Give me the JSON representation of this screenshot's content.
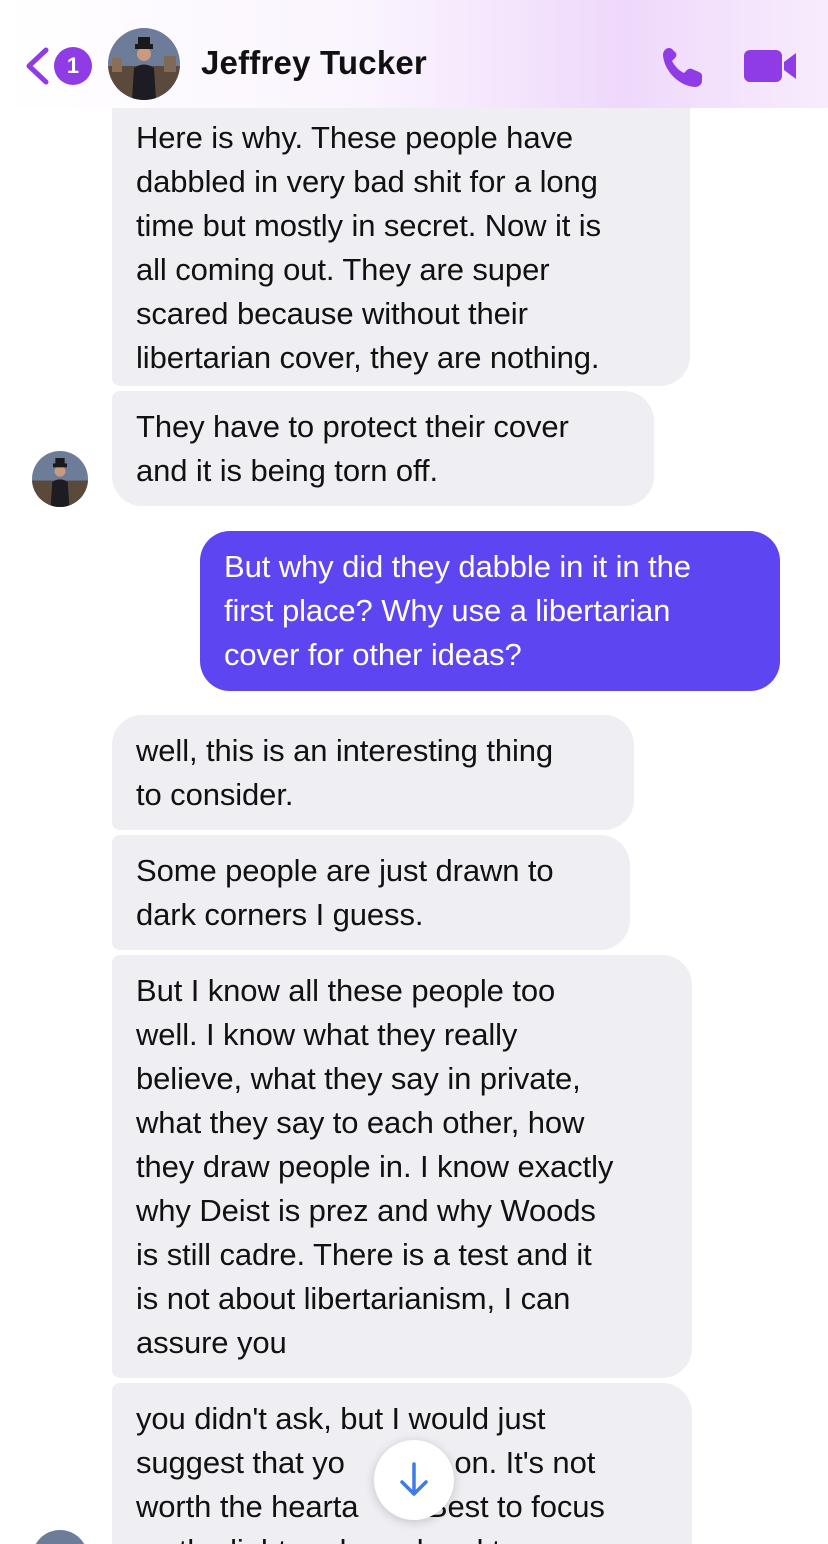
{
  "header": {
    "back_badge_count": "1",
    "contact_name": "Jeffrey Tucker",
    "accent_color": "#8f3ce6",
    "icons": [
      "chevron-left-icon",
      "phone-icon",
      "video-camera-icon"
    ]
  },
  "messages": [
    {
      "direction": "incoming",
      "lines": [
        "Here is why. These people have",
        "dabbled in very bad shit for a long",
        "time but mostly in secret. Now it is",
        "all coming out. They are super",
        "scared because without their",
        "libertarian cover, they are nothing."
      ]
    },
    {
      "direction": "incoming",
      "lines": [
        "They have to protect their cover",
        "and it is being torn off."
      ]
    },
    {
      "direction": "outgoing",
      "lines": [
        "But why did they dabble in it in the",
        "first place? Why use a libertarian",
        "cover for other ideas?"
      ]
    },
    {
      "direction": "incoming",
      "lines": [
        "well, this is an interesting thing",
        "to consider."
      ]
    },
    {
      "direction": "incoming",
      "lines": [
        "Some people are just drawn to",
        "dark corners I guess."
      ]
    },
    {
      "direction": "incoming",
      "lines": [
        "But I know all these people too",
        "well. I know what they really",
        "believe, what they say in private,",
        "what they say to each other, how",
        "they draw people in. I know exactly",
        "why Deist is prez and why Woods",
        "is still cadre. There is a test and it",
        "is not about libertarianism, I can",
        "assure you"
      ]
    },
    {
      "direction": "incoming",
      "lines": [
        "you didn't ask, but I would just",
        "suggest that yo    ve on. It's not",
        "worth the hearta   . Best to focus",
        "on the light and good and true"
      ]
    }
  ],
  "colors": {
    "incoming_bubble": "#efeef2",
    "outgoing_bubble": "#5d45f1",
    "scroll_arrow": "#3d7be8"
  }
}
